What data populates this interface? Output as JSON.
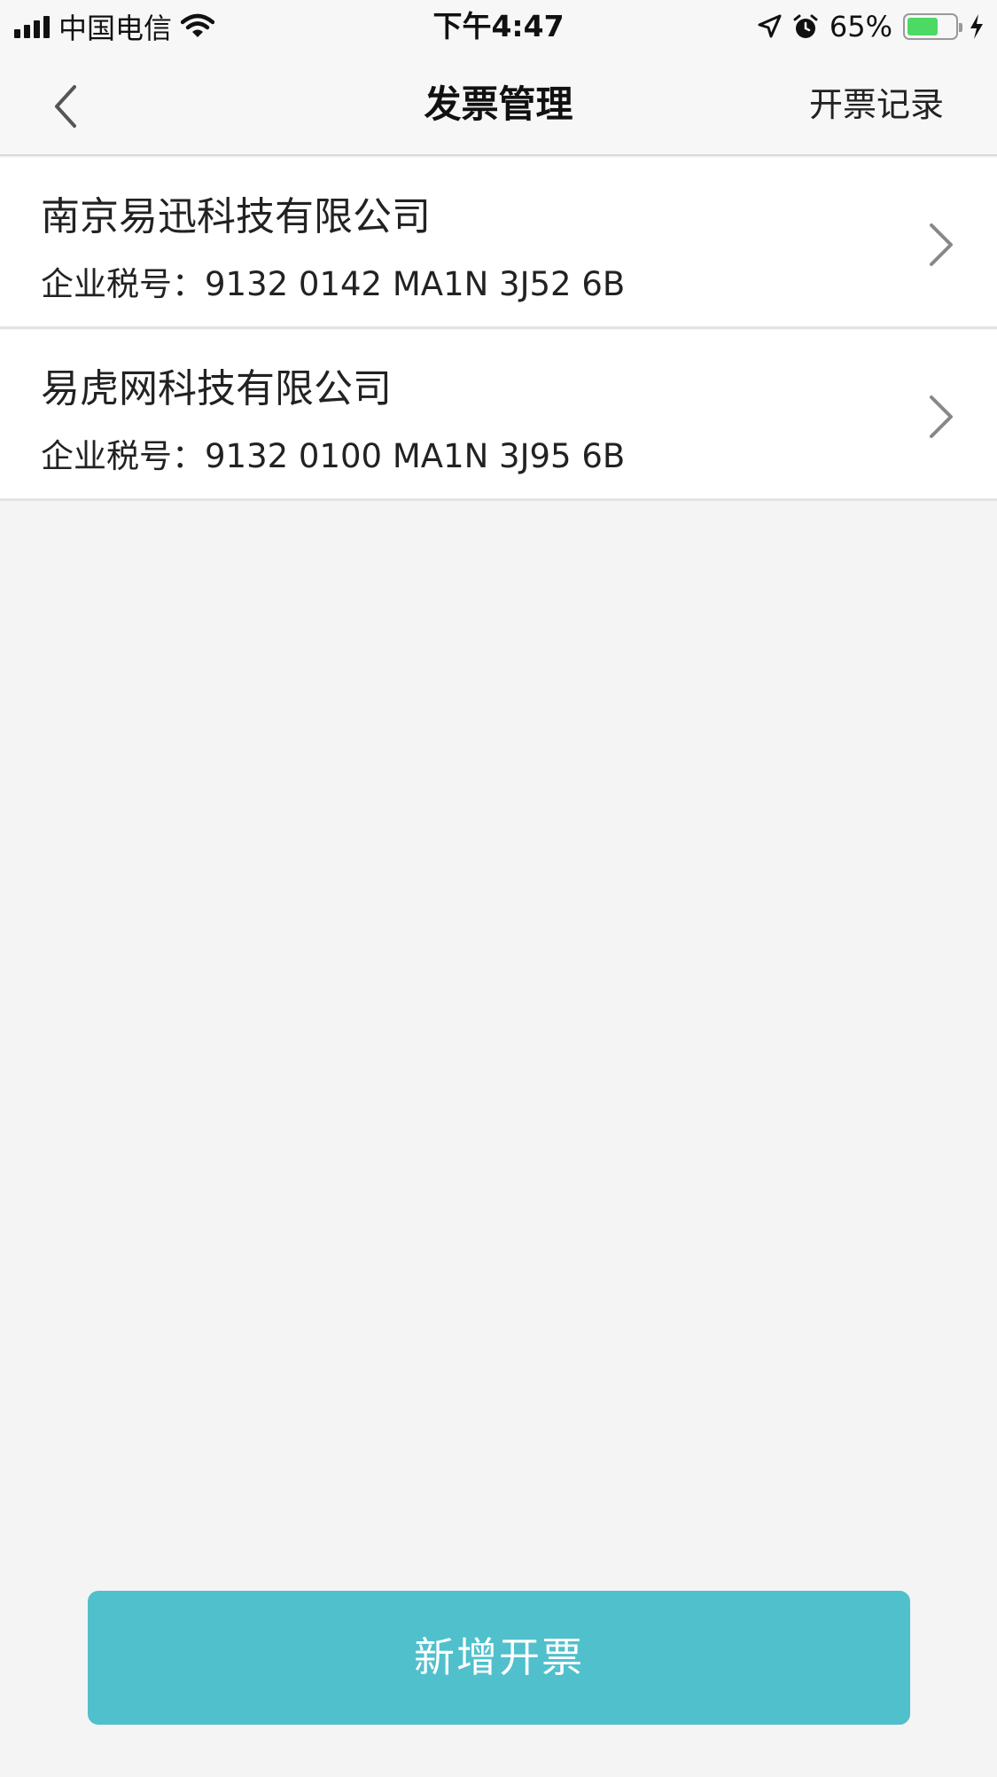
{
  "status_bar": {
    "carrier": "中国电信",
    "time": "下午4:47",
    "battery_percent": "65%",
    "battery_level": 0.65,
    "icons": [
      "signal-icon",
      "wifi-icon",
      "location-icon",
      "alarm-icon",
      "battery-icon",
      "charging-icon"
    ]
  },
  "nav": {
    "title": "发票管理",
    "right_action": "开票记录",
    "back_icon": "chevron-left-icon"
  },
  "companies": [
    {
      "name": "南京易迅科技有限公司",
      "tax_line": "企业税号：9132 0142 MA1N 3J52 6B"
    },
    {
      "name": "易虎网科技有限公司",
      "tax_line": "企业税号：9132 0100 MA1N 3J95 6B"
    }
  ],
  "footer": {
    "add_button_label": "新增开票"
  },
  "colors": {
    "accent": "#50c0cc",
    "background": "#f4f4f4",
    "battery": "#4cd964"
  }
}
